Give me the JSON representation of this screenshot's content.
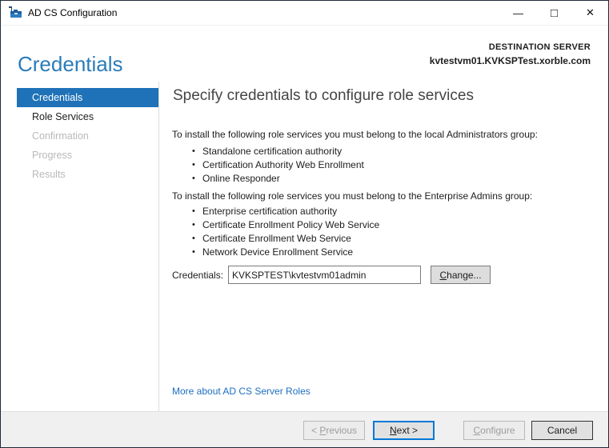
{
  "window": {
    "title": "AD CS Configuration",
    "controls": {
      "minimize_glyph": "—",
      "maximize_glyph": "□",
      "close_glyph": "✕"
    }
  },
  "header": {
    "title": "Credentials",
    "destination_label": "DESTINATION SERVER",
    "destination_server": "kvtestvm01.KVKSPTest.xorble.com"
  },
  "sidebar": {
    "items": [
      {
        "label": "Credentials",
        "state": "selected"
      },
      {
        "label": "Role Services",
        "state": "enabled"
      },
      {
        "label": "Confirmation",
        "state": "disabled"
      },
      {
        "label": "Progress",
        "state": "disabled"
      },
      {
        "label": "Results",
        "state": "disabled"
      }
    ]
  },
  "content": {
    "heading": "Specify credentials to configure role services",
    "bullet_glyph": "•",
    "sections": [
      {
        "intro": "To install the following role services you must belong to the local Administrators group:",
        "bullets": [
          "Standalone certification authority",
          "Certification Authority Web Enrollment",
          "Online Responder"
        ]
      },
      {
        "intro": "To install the following role services you must belong to the Enterprise Admins group:",
        "bullets": [
          "Enterprise certification authority",
          "Certificate Enrollment Policy Web Service",
          "Certificate Enrollment Web Service",
          "Network Device Enrollment Service"
        ]
      }
    ],
    "credentials": {
      "label": "Credentials:",
      "value": "KVKSPTEST\\kvtestvm01admin",
      "change_button": {
        "pre": "",
        "key": "C",
        "rest": "hange..."
      }
    },
    "link": "More about AD CS Server Roles"
  },
  "footer": {
    "buttons": [
      {
        "pre": "< ",
        "key": "P",
        "rest": "revious",
        "state": "disabled"
      },
      {
        "pre": "",
        "key": "N",
        "rest": "ext >",
        "state": "default"
      },
      {
        "pre": "",
        "key": "C",
        "rest": "onfigure",
        "state": "disabled"
      },
      {
        "pre": "",
        "key": "",
        "rest": "Cancel",
        "state": "enabled"
      }
    ]
  },
  "colors": {
    "accent_blue": "#1f72b8",
    "title_blue": "#2b7cb8",
    "link_blue": "#1d6ec0",
    "focus_border": "#0078d7",
    "footer_bg": "#f0f0f0",
    "window_border": "#202a3a"
  }
}
